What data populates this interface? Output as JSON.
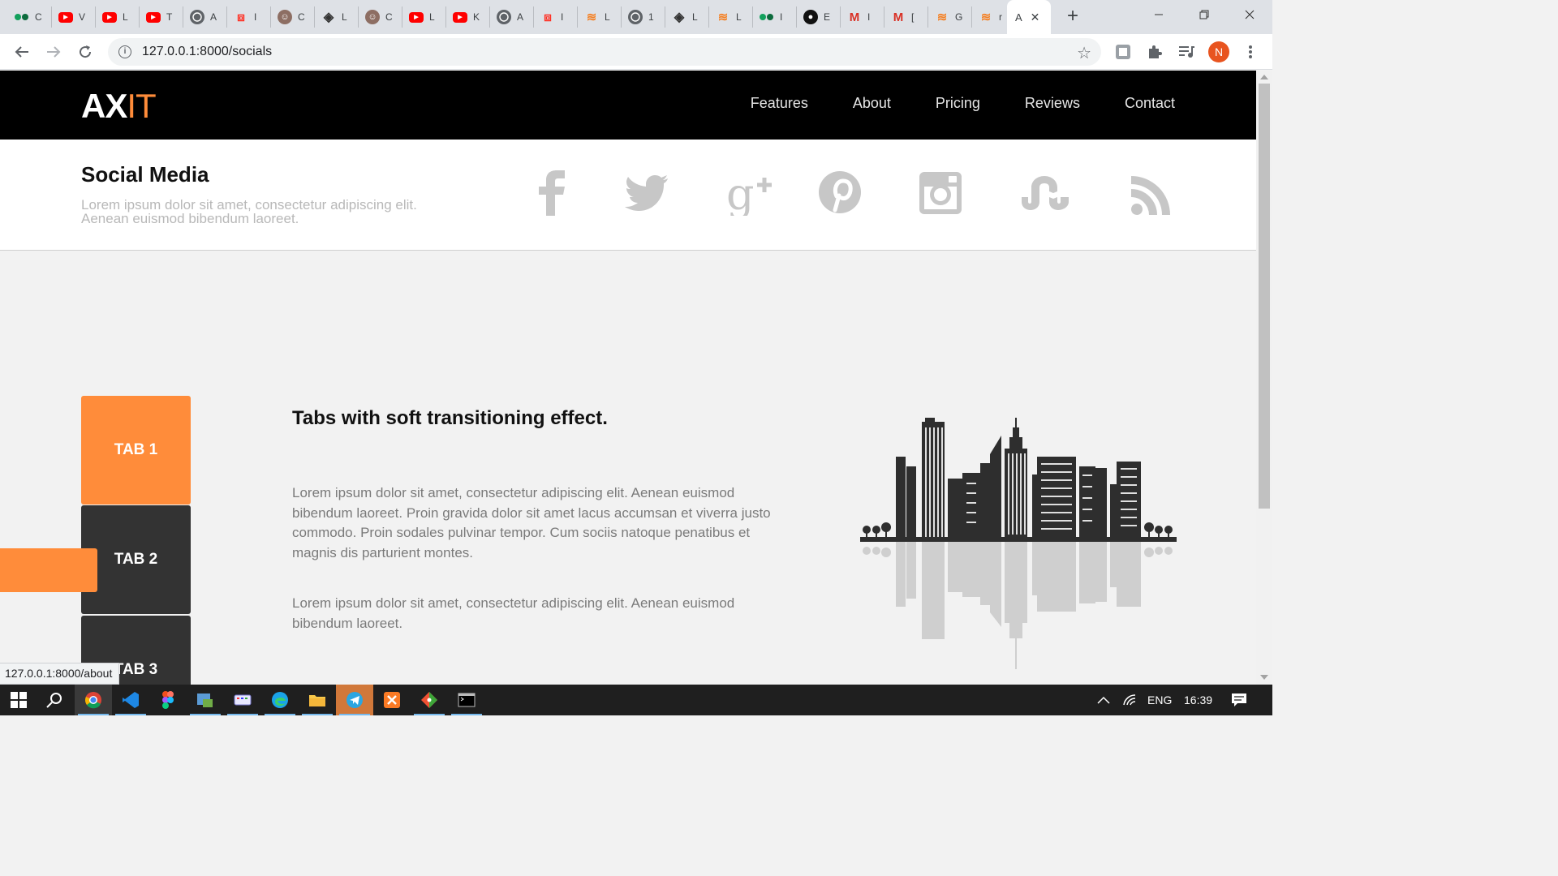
{
  "browser": {
    "background_tabs": [
      {
        "icon": "medium-icon",
        "title": "C",
        "color": "#12a05c"
      },
      {
        "icon": "youtube-icon",
        "title": "V",
        "color": "#ff0000"
      },
      {
        "icon": "youtube-icon",
        "title": "L",
        "color": "#ff0000"
      },
      {
        "icon": "youtube-icon",
        "title": "T",
        "color": "#ff0000"
      },
      {
        "icon": "globe-icon",
        "title": "A",
        "color": "#5f6368"
      },
      {
        "icon": "laravel-icon",
        "title": "I",
        "color": "#ff2d20"
      },
      {
        "icon": "avatar-icon",
        "title": "C",
        "color": "#8d6e63"
      },
      {
        "icon": "diamond-icon",
        "title": "L",
        "color": "#333333"
      },
      {
        "icon": "avatar-icon",
        "title": "C",
        "color": "#8d6e63"
      },
      {
        "icon": "youtube-icon",
        "title": "L",
        "color": "#ff0000"
      },
      {
        "icon": "youtube-icon",
        "title": "K",
        "color": "#ff0000"
      },
      {
        "icon": "globe-icon",
        "title": "A",
        "color": "#5f6368"
      },
      {
        "icon": "laravel-icon",
        "title": "I",
        "color": "#ff2d20"
      },
      {
        "icon": "stackoverflow-icon",
        "title": "L",
        "color": "#f48024"
      },
      {
        "icon": "globe-icon",
        "title": "1",
        "color": "#5f6368"
      },
      {
        "icon": "diamond-icon",
        "title": "L",
        "color": "#333333"
      },
      {
        "icon": "stackoverflow-icon",
        "title": "L",
        "color": "#f48024"
      },
      {
        "icon": "medium-icon",
        "title": "I",
        "color": "#12a05c"
      },
      {
        "icon": "github-icon",
        "title": "E",
        "color": "#111111"
      },
      {
        "icon": "gmail-icon",
        "title": "I",
        "color": "#d93025"
      },
      {
        "icon": "gmail-icon",
        "title": "[",
        "color": "#d93025"
      },
      {
        "icon": "stackoverflow-icon",
        "title": "G",
        "color": "#f48024"
      },
      {
        "icon": "stackoverflow-icon",
        "title": "r",
        "color": "#f48024"
      }
    ],
    "active_tab_title": "A",
    "url": "127.0.0.1:8000/socials",
    "profile_initial": "N",
    "status_url": "127.0.0.1:8000/about"
  },
  "site": {
    "logo_ax": "AX",
    "logo_it": "IT",
    "nav": [
      "Features",
      "About",
      "Pricing",
      "Reviews",
      "Contact"
    ],
    "accent_color": "#ff8c3a"
  },
  "social": {
    "title": "Social Media",
    "description": "Lorem ipsum dolor sit amet, consectetur adipiscing elit. Aenean euismod bibendum laoreet.",
    "icons": [
      "facebook-icon",
      "twitter-icon",
      "google-plus-icon",
      "pinterest-icon",
      "instagram-icon",
      "stumbleupon-icon",
      "rss-icon"
    ]
  },
  "tabs": {
    "items": [
      "TAB 1",
      "TAB 2",
      "TAB 3"
    ],
    "active": 0,
    "heading": "Tabs with soft transitioning effect.",
    "paragraph1": "Lorem ipsum dolor sit amet, consectetur adipiscing elit. Aenean euismod bibendum laoreet. Proin gravida dolor sit amet lacus accumsan et viverra justo commodo. Proin sodales pulvinar tempor. Cum sociis natoque penatibus et magnis dis parturient montes.",
    "paragraph2": "Lorem ipsum dolor sit amet, consectetur adipiscing elit. Aenean euismod bibendum laoreet.",
    "image": "city-skyline-reflection"
  },
  "taskbar": {
    "apps": [
      "chrome-icon",
      "vscode-icon",
      "figma-icon",
      "taskbar-app-icon",
      "keyboard-icon",
      "edge-icon",
      "file-explorer-icon",
      "telegram-icon",
      "xampp-icon",
      "git-icon",
      "terminal-icon"
    ],
    "language": "ENG",
    "time": "16:39"
  }
}
